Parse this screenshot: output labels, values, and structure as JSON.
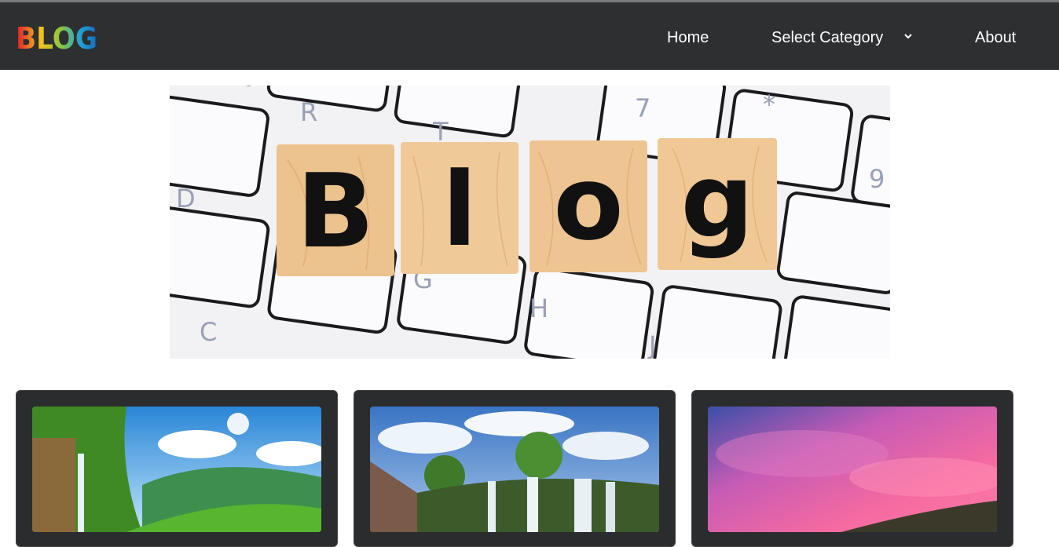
{
  "brand": {
    "logo_text": "BLOG"
  },
  "nav": {
    "home": "Home",
    "category": "Select Category",
    "about": "About"
  },
  "hero": {
    "tile_letters": [
      "B",
      "l",
      "o",
      "g"
    ],
    "key_letters": [
      "R",
      "T",
      "7",
      "*",
      "D",
      "9",
      "G",
      "H",
      "C",
      "J"
    ]
  },
  "cards": [
    {
      "image": "waterfall-forest-image"
    },
    {
      "image": "waterfall-cliff-image"
    },
    {
      "image": "pink-sky-image"
    }
  ],
  "colors": {
    "navbar": "#2e2f31",
    "card": "#2b2c2e"
  }
}
